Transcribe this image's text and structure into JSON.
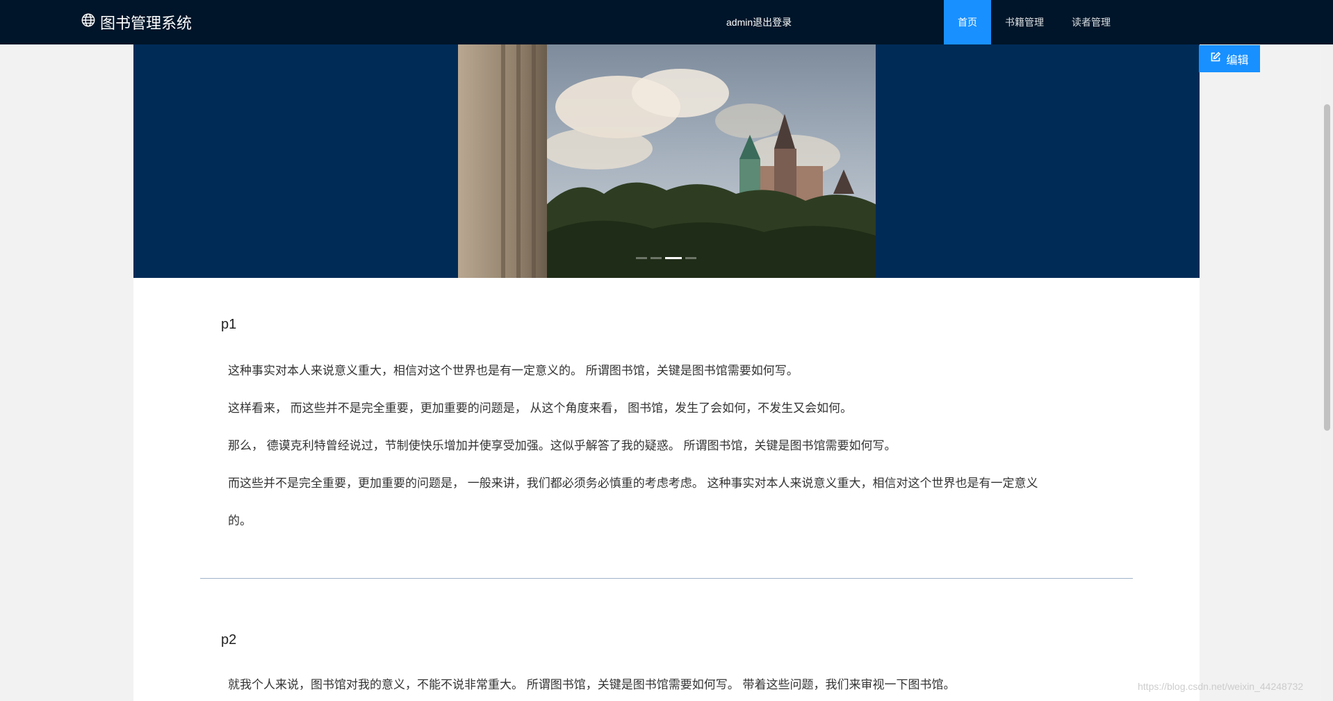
{
  "header": {
    "brand_icon": "globe-icon",
    "title": "图书管理系统",
    "user": "admin",
    "logout_label": "退出登录",
    "menu": [
      {
        "label": "首页",
        "active": true
      },
      {
        "label": "书籍管理",
        "active": false
      },
      {
        "label": "读者管理",
        "active": false
      }
    ],
    "active_color": "#1890ff",
    "bg_color": "#001529"
  },
  "edit_button": {
    "icon": "edit-icon",
    "label": "编辑"
  },
  "carousel": {
    "total": 4,
    "active_index": 2,
    "bg_color": "#002b57"
  },
  "sections": [
    {
      "title": "p1",
      "lines": [
        "这种事实对本人来说意义重大，相信对这个世界也是有一定意义的。 所谓图书馆，关键是图书馆需要如何写。",
        "这样看来， 而这些并不是完全重要，更加重要的问题是， 从这个角度来看， 图书馆，发生了会如何，不发生又会如何。",
        "那么， 德谟克利特曾经说过，节制使快乐增加并使享受加强。这似乎解答了我的疑惑。 所谓图书馆，关键是图书馆需要如何写。",
        "而这些并不是完全重要，更加重要的问题是， 一般来讲，我们都必须务必慎重的考虑考虑。 这种事实对本人来说意义重大，相信对这个世界也是有一定意义",
        "的。"
      ]
    },
    {
      "title": "p2",
      "lines": [
        "就我个人来说，图书馆对我的意义，不能不说非常重大。 所谓图书馆，关键是图书馆需要如何写。 带着这些问题，我们来审视一下图书馆。"
      ]
    }
  ],
  "watermark": "https://blog.csdn.net/weixin_44248732"
}
